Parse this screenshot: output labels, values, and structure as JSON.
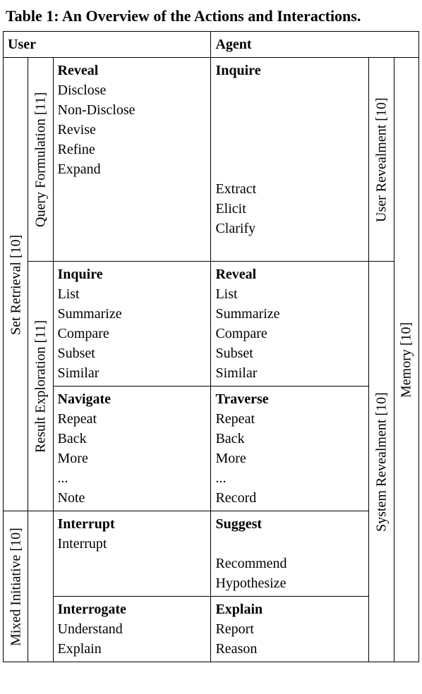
{
  "caption": "Table 1: An Overview of the Actions and Interactions.",
  "headers": {
    "user": "User",
    "agent": "Agent"
  },
  "leftLabels": {
    "setRetrieval": "Set Retrieval [10]",
    "mixedInitiative": "Mixed Initiative [10]",
    "queryFormulation": "Query Formulation [11]",
    "resultExploration": "Result Exploration [11]"
  },
  "rightLabels": {
    "userRevealment": "User Revealment [10]",
    "systemRevealment": "System Revealment [10]",
    "memory": "Memory [10]"
  },
  "cells": {
    "r1_user_head": "Reveal",
    "r1_user_items": [
      "Disclose",
      "Non-Disclose",
      "Revise",
      "Refine",
      "Expand",
      " ",
      " ",
      " ",
      " "
    ],
    "r1_agent_head": "Inquire",
    "r1_agent_items": [
      " ",
      " ",
      " ",
      " ",
      " ",
      "Extract",
      "Elicit",
      "Clarify",
      " "
    ],
    "r2_user_head": "Inquire",
    "r2_user_items": [
      "List",
      "Summarize",
      "Compare",
      "Subset",
      "Similar"
    ],
    "r2_agent_head": "Reveal",
    "r2_agent_items": [
      "List",
      "Summarize",
      "Compare",
      "Subset",
      "Similar"
    ],
    "r3_user_head": "Navigate",
    "r3_user_items": [
      "Repeat",
      "Back",
      "More",
      "...",
      "Note"
    ],
    "r3_agent_head": "Traverse",
    "r3_agent_items": [
      "Repeat",
      "Back",
      "More",
      "...",
      "Record"
    ],
    "r4_user_head": "Interrupt",
    "r4_user_items": [
      "Interrupt",
      " ",
      " "
    ],
    "r4_agent_head": "Suggest",
    "r4_agent_items": [
      " ",
      "Recommend",
      "Hypothesize"
    ],
    "r5_user_head": "Interrogate",
    "r5_user_items": [
      "Understand",
      "Explain"
    ],
    "r5_agent_head": "Explain",
    "r5_agent_items": [
      "Report",
      "Reason"
    ]
  }
}
